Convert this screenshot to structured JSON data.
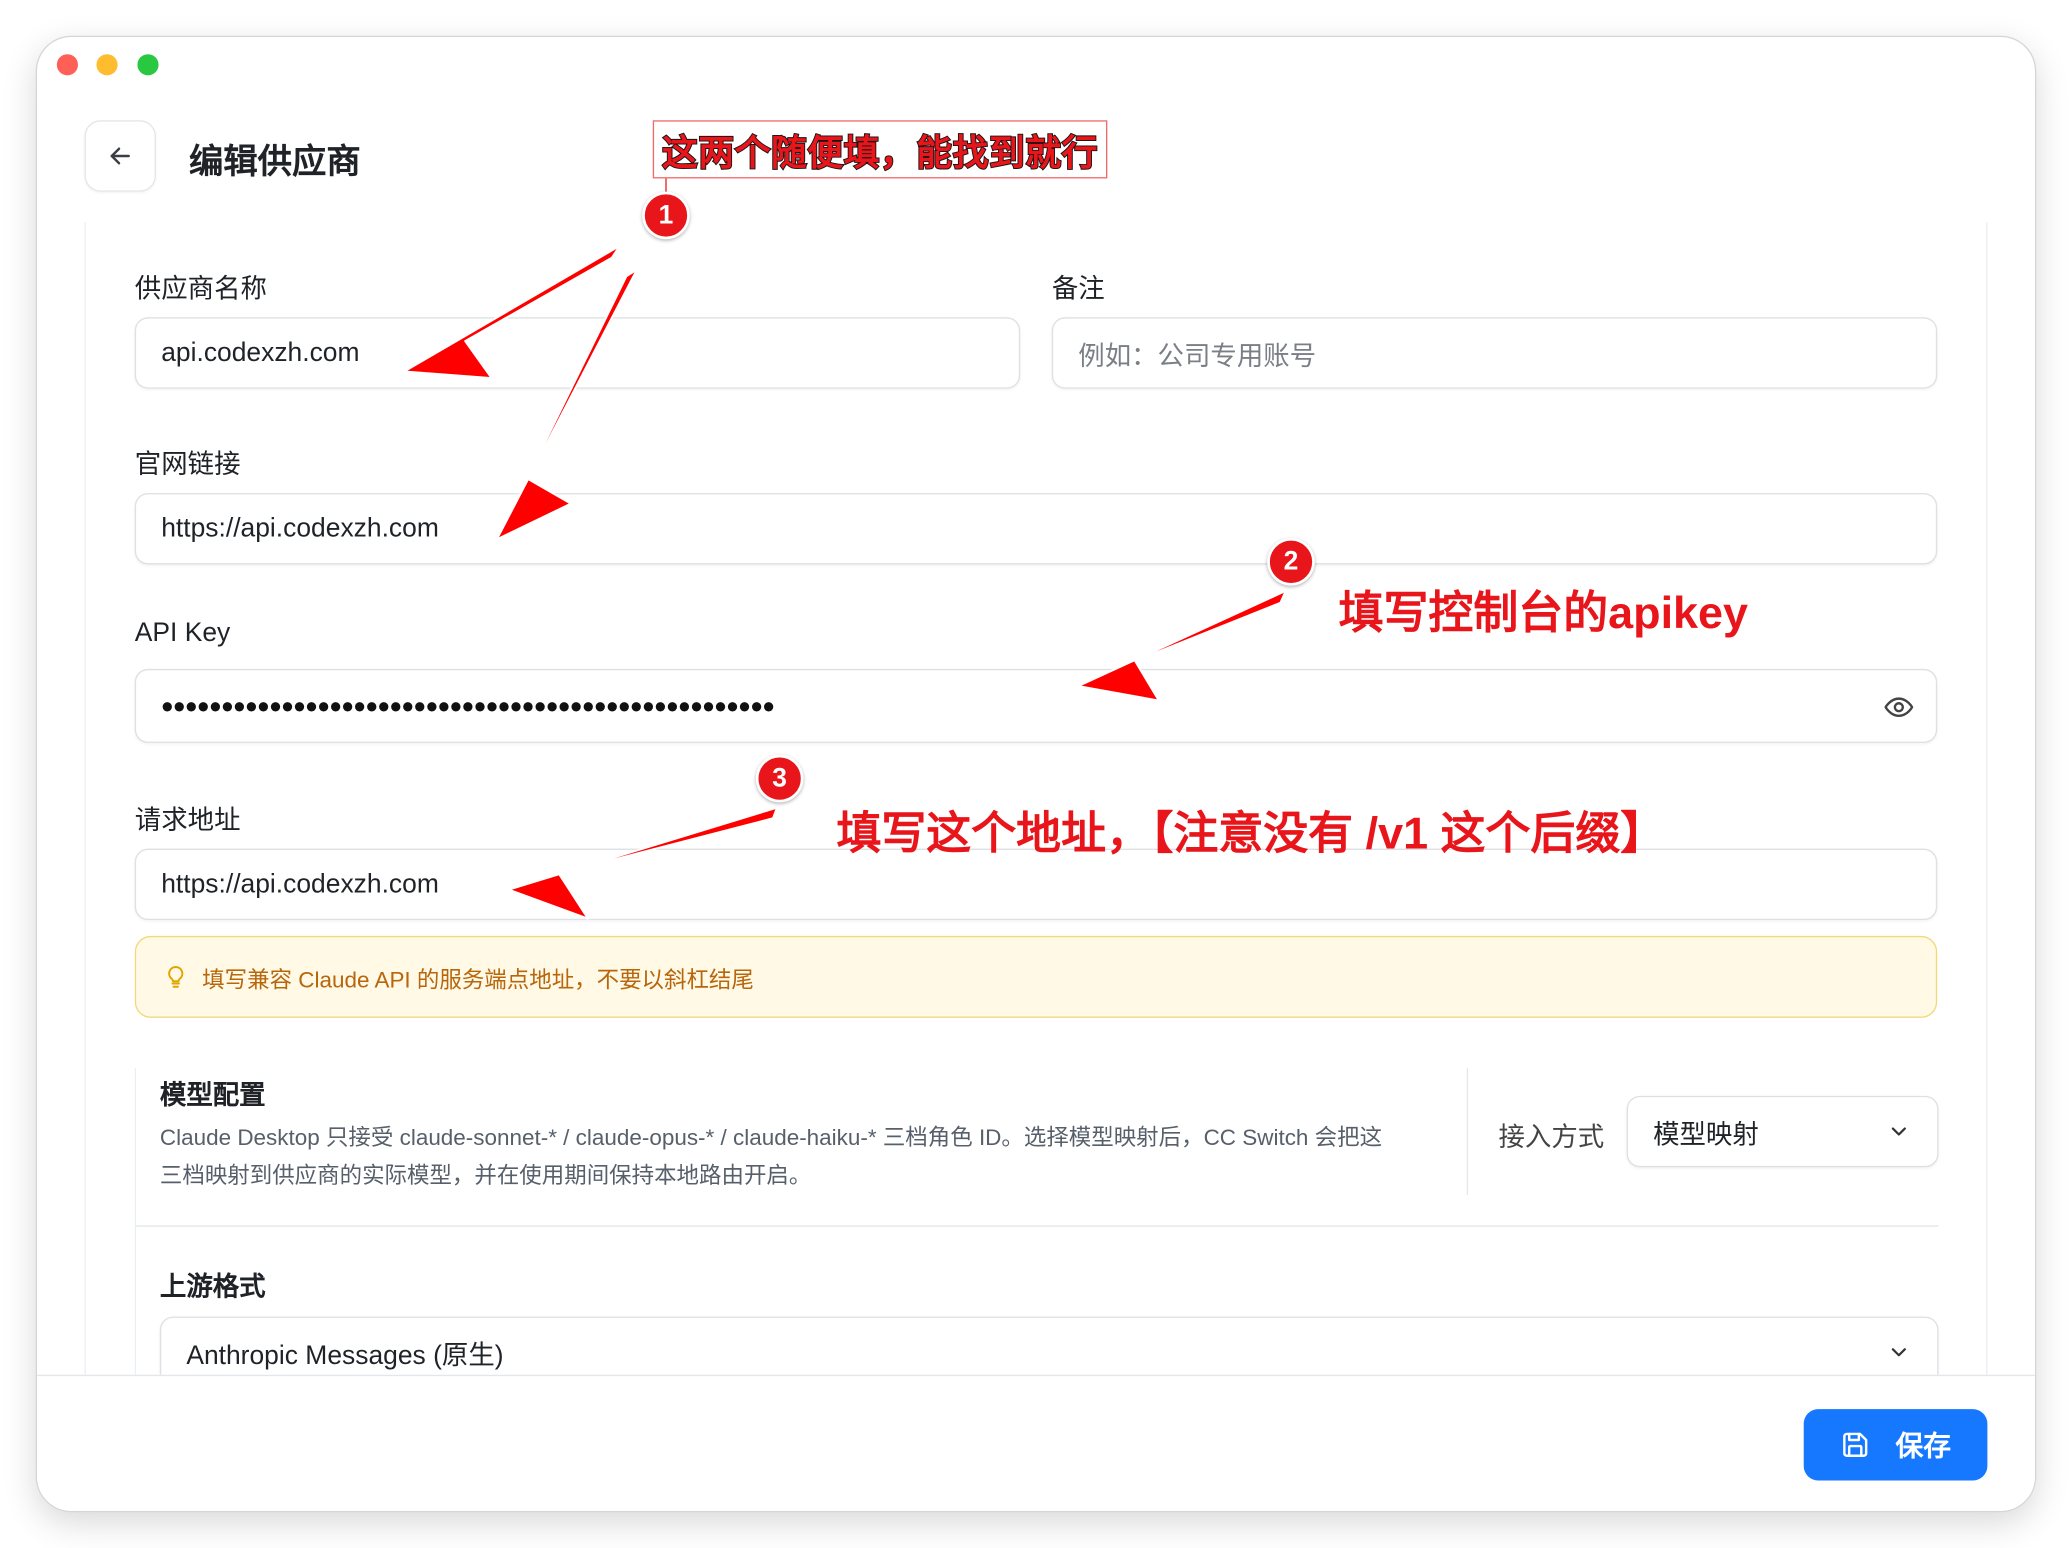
{
  "header": {
    "title": "编辑供应商"
  },
  "form": {
    "provider_name_label": "供应商名称",
    "provider_name_value": "api.codexzh.com",
    "notes_label": "备注",
    "notes_placeholder": "例如：公司专用账号",
    "website_label": "官网链接",
    "website_value": "https://api.codexzh.com",
    "apikey_label": "API Key",
    "apikey_masked": "•••••••••••••••••••••••••••••••••••••••••••••••••••",
    "endpoint_label": "请求地址",
    "endpoint_value": "https://api.codexzh.com",
    "endpoint_hint": "填写兼容 Claude API 的服务端点地址，不要以斜杠结尾"
  },
  "model_config": {
    "title": "模型配置",
    "description": "Claude Desktop 只接受 claude-sonnet-* / claude-opus-* / claude-haiku-* 三档角色 ID。选择模型映射后，CC Switch 会把这三档映射到供应商的实际模型，并在使用期间保持本地路由开启。",
    "access_mode_label": "接入方式",
    "access_mode_value": "模型映射",
    "upstream_format_label": "上游格式",
    "upstream_format_value": "Anthropic Messages (原生)"
  },
  "footer": {
    "save_label": "保存"
  },
  "annotations": {
    "box_text": "这两个随便填，能找到就行",
    "badge1": "1",
    "badge2": "2",
    "badge3": "3",
    "note2": "填写控制台的apikey",
    "note3": "填写这个地址，【注意没有 /v1 这个后缀】"
  },
  "icons": {
    "back": "arrow-left-icon",
    "eye": "eye-icon",
    "hint": "lightbulb-icon",
    "chevron": "chevron-down-icon",
    "save": "save-icon"
  },
  "colors": {
    "accent": "#1677ff",
    "annotation_red": "#e8151b",
    "hint_bg": "#fff9e6",
    "hint_text": "#b8660b"
  }
}
